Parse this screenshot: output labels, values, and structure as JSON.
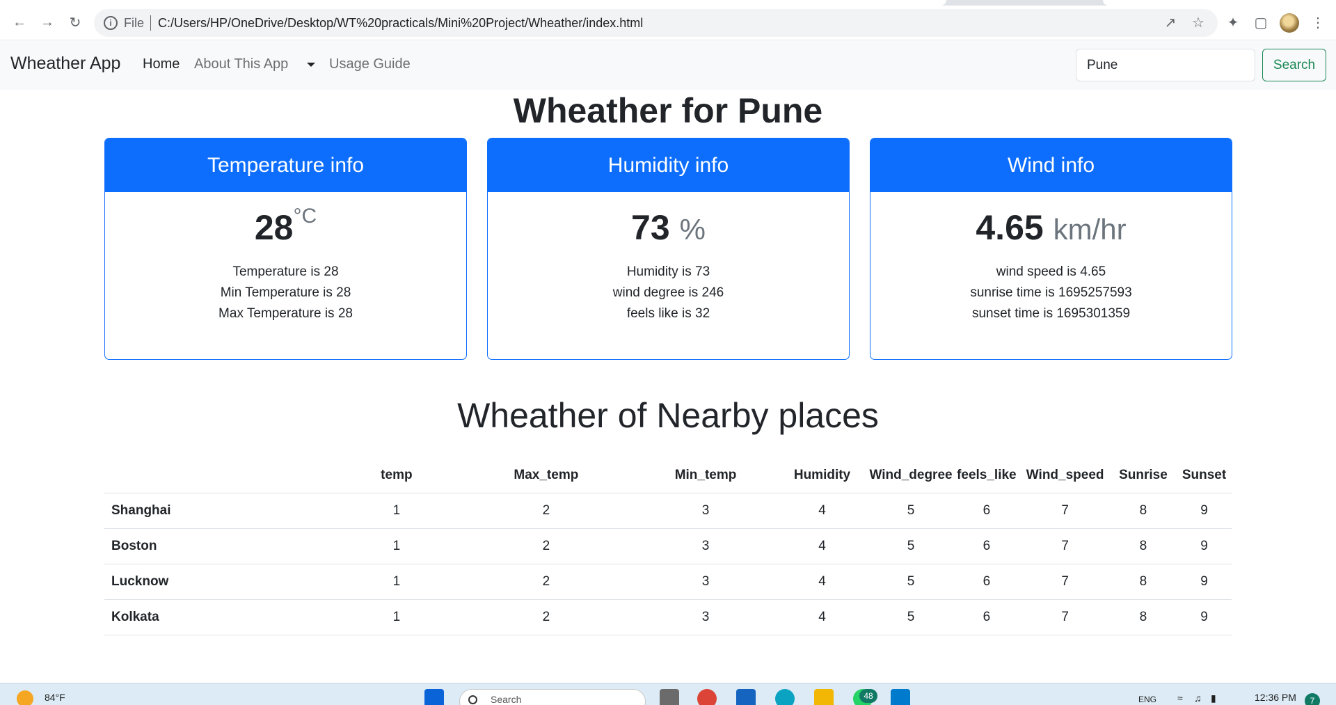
{
  "browser": {
    "url_scheme": "File",
    "url": "C:/Users/HP/OneDrive/Desktop/WT%20practicals/Mini%20Project/Wheather/index.html"
  },
  "navbar": {
    "brand": "Wheather App",
    "links": [
      "Home",
      "About This App",
      "Usage Guide"
    ],
    "search_value": "Pune",
    "search_button": "Search"
  },
  "page_title": "Wheather for Pune",
  "cards": {
    "temperature": {
      "header": "Temperature info",
      "value": "28",
      "unit": "°C",
      "lines": [
        "Temperature is 28",
        "Min Temperature is 28",
        "Max Temperature is 28"
      ]
    },
    "humidity": {
      "header": "Humidity info",
      "value": "73",
      "unit": "%",
      "lines": [
        "Humidity is 73",
        "wind degree is 246",
        "feels like is 32"
      ]
    },
    "wind": {
      "header": "Wind info",
      "value": "4.65",
      "unit": "km/hr",
      "lines": [
        "wind speed is 4.65",
        "sunrise time is 1695257593",
        "sunset time is 1695301359"
      ]
    }
  },
  "nearby": {
    "title": "Wheather of Nearby places",
    "columns": [
      "",
      "temp",
      "Max_temp",
      "Min_temp",
      "Humidity",
      "Wind_degree",
      "feels_like",
      "Wind_speed",
      "Sunrise",
      "Sunset"
    ],
    "rows": [
      {
        "city": "Shanghai",
        "values": [
          "1",
          "2",
          "3",
          "4",
          "5",
          "6",
          "7",
          "8",
          "9"
        ]
      },
      {
        "city": "Boston",
        "values": [
          "1",
          "2",
          "3",
          "4",
          "5",
          "6",
          "7",
          "8",
          "9"
        ]
      },
      {
        "city": "Lucknow",
        "values": [
          "1",
          "2",
          "3",
          "4",
          "5",
          "6",
          "7",
          "8",
          "9"
        ]
      },
      {
        "city": "Kolkata",
        "values": [
          "1",
          "2",
          "3",
          "4",
          "5",
          "6",
          "7",
          "8",
          "9"
        ]
      }
    ]
  },
  "taskbar": {
    "weather_temp": "84°F",
    "search_placeholder": "Search",
    "whatsapp_badge": "48",
    "language": "ENG",
    "time": "12:36 PM",
    "notifications": "7"
  },
  "colors": {
    "primary": "#0d6efd",
    "success": "#198754",
    "navbar_bg": "#f8f9fa",
    "taskbar_bg": "#dcebf5"
  }
}
